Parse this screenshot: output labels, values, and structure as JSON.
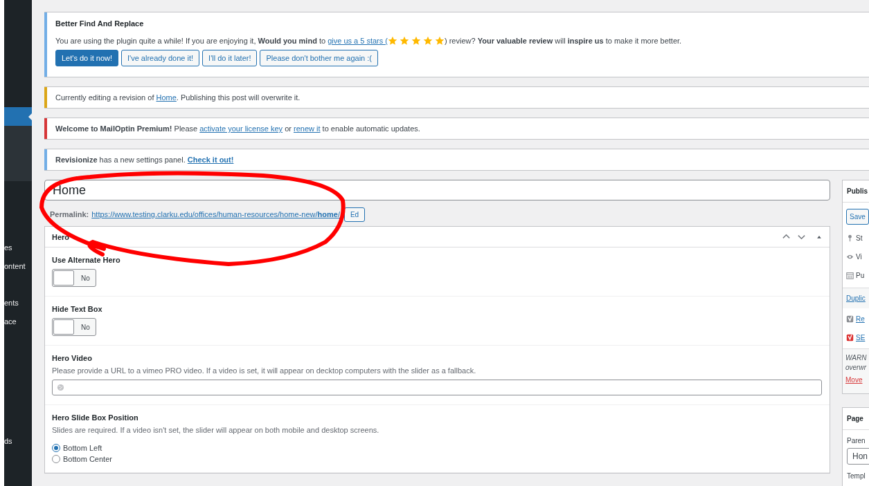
{
  "sidebar": {
    "items": [
      {
        "label": "es"
      },
      {
        "label": "ontent"
      },
      {
        "label": "ents"
      },
      {
        "label": "ace"
      },
      {
        "label": "ds"
      }
    ]
  },
  "notices": [
    {
      "kind": "rating",
      "color": "#72aee6",
      "title": "Better Find And Replace",
      "before": "You are using the plugin quite a while! If you are enjoying it, **Would you mind** to ",
      "link": "give us a 5 stars (",
      "stars": 5,
      "after": ") review? **Your valuable review** will **inspire us** to make it more better.",
      "buttons": [
        {
          "label": "Let's do it now!",
          "primary": true
        },
        {
          "label": "I've already done it!",
          "primary": false
        },
        {
          "label": "I'll do it later!",
          "primary": false
        },
        {
          "label": "Please don't bother me again :(",
          "primary": false
        }
      ]
    },
    {
      "kind": "text",
      "color": "#dba617",
      "parts": [
        {
          "text": "Currently editing a revision of "
        },
        {
          "link": "Home",
          "bold": false
        },
        {
          "text": ". Publishing this post will overwrite it."
        }
      ]
    },
    {
      "kind": "text",
      "color": "#d63638",
      "parts": [
        {
          "text": "**Welcome to MailOptin Premium!** Please "
        },
        {
          "link": "activate your license key",
          "bold": false
        },
        {
          "text": " or "
        },
        {
          "link": "renew it",
          "bold": false
        },
        {
          "text": " to enable automatic updates."
        }
      ]
    },
    {
      "kind": "text",
      "color": "#72aee6",
      "parts": [
        {
          "text": "**Revisionize** has a new settings panel. "
        },
        {
          "link": "Check it out!",
          "bold": true
        }
      ]
    }
  ],
  "post": {
    "title": "Home",
    "permalink_label": "Permalink:",
    "permalink": "https://www.testing.clarku.edu/offices/human-resources/home-new/**home**/",
    "edit_button": "Ed"
  },
  "metabox": {
    "title": "Hero",
    "fields": [
      {
        "kind": "toggle",
        "label": "Use Alternate Hero",
        "on": false,
        "state_label": "No"
      },
      {
        "kind": "toggle",
        "label": "Hide Text Box",
        "on": false,
        "state_label": "No"
      },
      {
        "kind": "url",
        "label": "Hero Video",
        "description": "Please provide a URL to a vimeo PRO video. If a video is set, it will appear on decktop computers with the slider as a fallback."
      },
      {
        "kind": "radio",
        "label": "Hero Slide Box Position",
        "description": "Slides are required. If a video isn't set, the slider will appear on both mobile and desktop screens.",
        "options": [
          {
            "label": "Bottom Left",
            "selected": true
          },
          {
            "label": "Bottom Center",
            "selected": false
          }
        ]
      }
    ]
  },
  "publish": {
    "title": "Publis",
    "save_button": "Save",
    "rows": [
      "St",
      "Vi",
      "Pu"
    ],
    "duplicate_link": "Duplic",
    "seo_rows": [
      {
        "label": "Re",
        "color": "#8c8f94"
      },
      {
        "label": "SE",
        "color": "#dc3232"
      }
    ],
    "warning_lines": [
      "WARN",
      "overwr"
    ],
    "move_link": "Move"
  },
  "page_attributes": {
    "title": "Page",
    "parent_label": "Paren",
    "parent_value": "Hon",
    "template_label": "Templ"
  }
}
